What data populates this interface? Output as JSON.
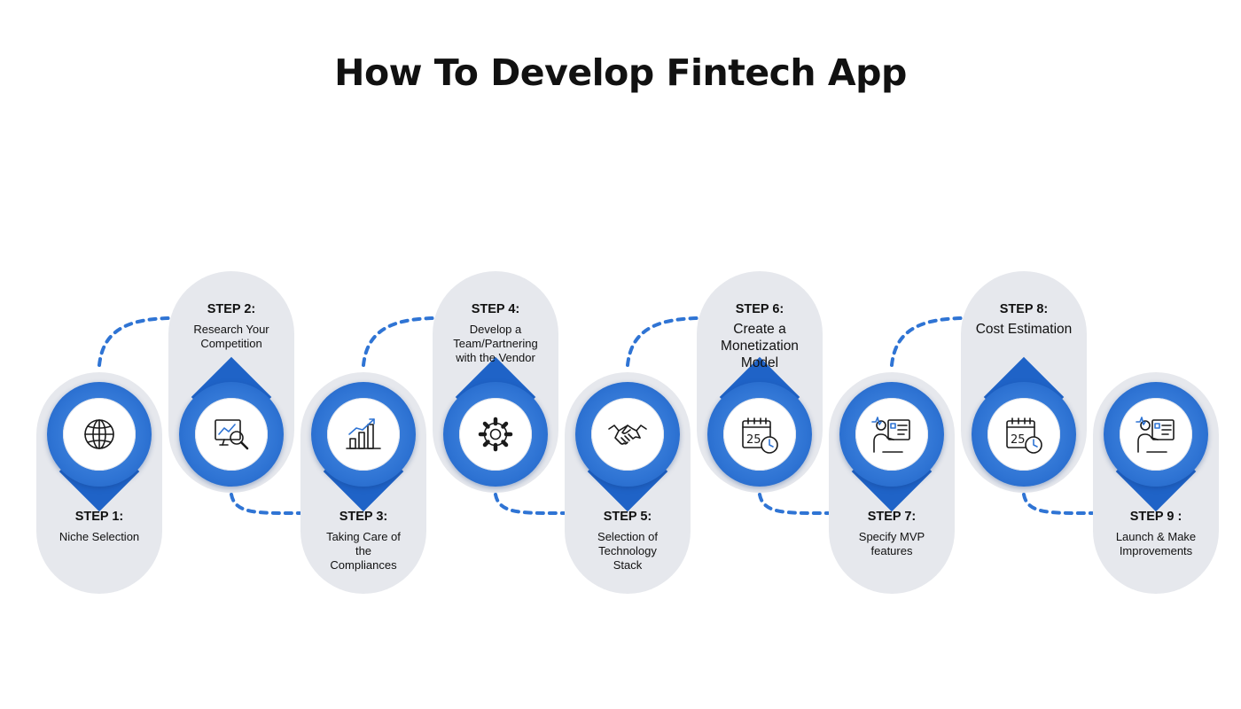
{
  "title": "How To Develop Fintech App",
  "colors": {
    "accent": "#2f74d4",
    "accent_dark": "#1f63c7",
    "pill": "#e6e8ed",
    "connector": "#2f74d4",
    "text": "#111111"
  },
  "steps": [
    {
      "step": "STEP 1:",
      "text": "Niche Selection",
      "icon": "globe-icon"
    },
    {
      "step": "STEP 2:",
      "text": "Research Your Competition",
      "icon": "analytics-search-icon"
    },
    {
      "step": "STEP 3:",
      "text": "Taking Care of the Compliances",
      "icon": "bar-chart-icon"
    },
    {
      "step": "STEP 4:",
      "text": "Develop a Team/Partnering with the Vendor",
      "icon": "gear-icon"
    },
    {
      "step": "STEP 5:",
      "text": "Selection of Technology Stack",
      "icon": "handshake-icon"
    },
    {
      "step": "STEP 6:",
      "text": "Create a Monetization Model",
      "icon": "calendar-clock-icon",
      "date": "25"
    },
    {
      "step": "STEP 7:",
      "text": "Specify MVP features",
      "icon": "person-dashboard-icon"
    },
    {
      "step": "STEP 8:",
      "text": "Cost Estimation",
      "icon": "calendar-clock-icon",
      "date": "25"
    },
    {
      "step": "STEP 9 :",
      "text": "Launch & Make Improvements",
      "icon": "person-dashboard-icon"
    }
  ]
}
